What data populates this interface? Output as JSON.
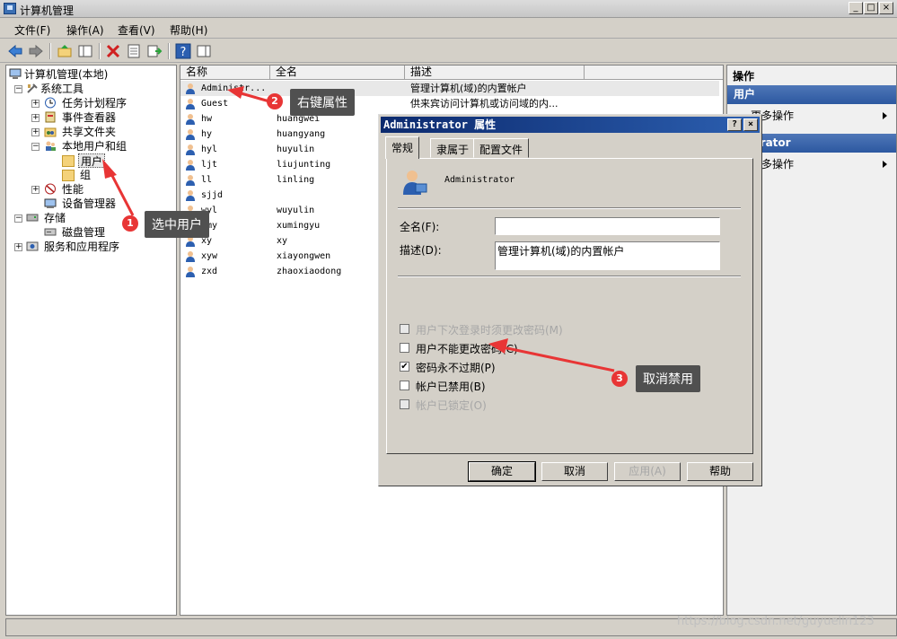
{
  "window": {
    "title": "计算机管理",
    "min": "_",
    "max": "□",
    "close": "×"
  },
  "menu": [
    "文件(F)",
    "操作(A)",
    "查看(V)",
    "帮助(H)"
  ],
  "tree": {
    "root": "计算机管理(本地)",
    "system_tools": "系统工具",
    "task_scheduler": "任务计划程序",
    "event_viewer": "事件查看器",
    "shared_folders": "共享文件夹",
    "local_users": "本地用户和组",
    "users": "用户",
    "groups": "组",
    "performance": "性能",
    "device_manager": "设备管理器",
    "storage": "存储",
    "disk_mgmt": "磁盘管理",
    "services": "服务和应用程序"
  },
  "list": {
    "columns": [
      "名称",
      "全名",
      "描述"
    ],
    "rows": [
      {
        "name": "Administr...",
        "full": "",
        "desc": "管理计算机(域)的内置帐户"
      },
      {
        "name": "Guest",
        "full": "",
        "desc": "供来宾访问计算机或访问域的内..."
      },
      {
        "name": "hw",
        "full": "huangwei",
        "desc": ""
      },
      {
        "name": "hy",
        "full": "huangyang",
        "desc": ""
      },
      {
        "name": "hyl",
        "full": "huyulin",
        "desc": ""
      },
      {
        "name": "ljt",
        "full": "liujunting",
        "desc": ""
      },
      {
        "name": "ll",
        "full": "linling",
        "desc": ""
      },
      {
        "name": "sjjd",
        "full": "",
        "desc": ""
      },
      {
        "name": "wyl",
        "full": "wuyulin",
        "desc": ""
      },
      {
        "name": "xmy",
        "full": "xumingyu",
        "desc": ""
      },
      {
        "name": "xy",
        "full": "xy",
        "desc": ""
      },
      {
        "name": "xyw",
        "full": "xiayongwen",
        "desc": ""
      },
      {
        "name": "zxd",
        "full": "zhaoxiaodong",
        "desc": ""
      }
    ]
  },
  "actions": {
    "header": "操作",
    "sec1": "用户",
    "sec1_item": "更多操作",
    "sec2": "inistrator",
    "sec2_item": "更多操作"
  },
  "dialog": {
    "title": "Administrator 属性",
    "tabs": [
      "常规",
      "隶属于",
      "配置文件"
    ],
    "username": "Administrator",
    "fullname_label": "全名(F):",
    "fullname_value": "",
    "desc_label": "描述(D):",
    "desc_value": "管理计算机(域)的内置帐户",
    "checks": [
      {
        "label": "用户下次登录时须更改密码(M)",
        "checked": false,
        "disabled": true
      },
      {
        "label": "用户不能更改密码(C)",
        "checked": false,
        "disabled": false
      },
      {
        "label": "密码永不过期(P)",
        "checked": true,
        "disabled": false
      },
      {
        "label": "帐户已禁用(B)",
        "checked": false,
        "disabled": false
      },
      {
        "label": "帐户已锁定(O)",
        "checked": false,
        "disabled": true
      }
    ],
    "buttons": {
      "ok": "确定",
      "cancel": "取消",
      "apply": "应用(A)",
      "help": "帮助"
    },
    "close": "×",
    "help_icon": "?"
  },
  "annotations": {
    "n1": "1",
    "c1": "选中用户",
    "n2": "2",
    "c2": "右键属性",
    "n3": "3",
    "c3": "取消禁用",
    "arrow_color": "#e83535"
  },
  "watermark": "https://blog.csdn.net/guyuelin123"
}
